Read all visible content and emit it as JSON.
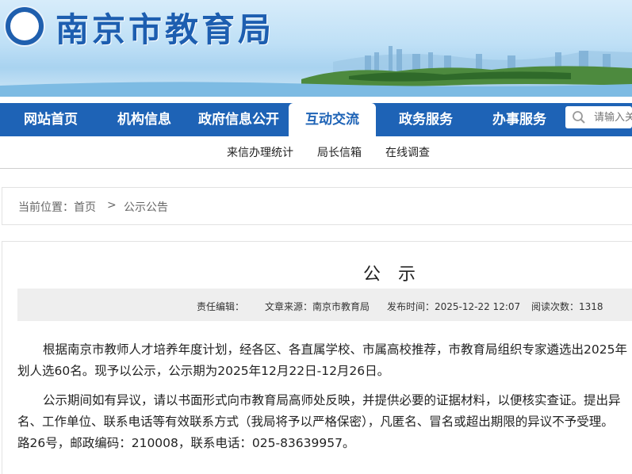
{
  "header": {
    "site_title": "南京市教育局",
    "logo_name": "nanjing-education-emblem"
  },
  "nav": {
    "items": [
      {
        "label": "网站首页"
      },
      {
        "label": "机构信息"
      },
      {
        "label": "政府信息公开"
      },
      {
        "label": "互动交流",
        "active": true
      },
      {
        "label": "政务服务"
      },
      {
        "label": "办事服务"
      }
    ],
    "search_placeholder": "请输入关",
    "colors": {
      "nav_bg": "#1e63b6",
      "active_text": "#1e63b6"
    }
  },
  "subnav": {
    "items": [
      {
        "label": "来信办理统计"
      },
      {
        "label": "局长信箱"
      },
      {
        "label": "在线调查"
      }
    ]
  },
  "breadcrumb": {
    "prefix": "当前位置：",
    "home": "首页",
    "separator": ">",
    "current": "公示公告"
  },
  "article": {
    "title": "公示",
    "meta": {
      "editor": "责任编辑：",
      "source": "文章来源：南京市教育局",
      "published": "发布时间：2025-12-22 12:07",
      "views": "阅读次数：1318"
    },
    "paragraphs": [
      {
        "line1": "根据南京市教师人才培养年度计划，经各区、各直属学校、市属高校推荐，市教育局组织专家遴选出2025年",
        "line2": "划人选60名。现予以公示，公示期为2025年12月22日-12月26日。"
      },
      {
        "line1": "公示期间如有异议，请以书面形式向市教育局高师处反映，并提供必要的证据材料，以便核实查证。提出异",
        "line2": "名、工作单位、联系电话等有效联系方式（我局将予以严格保密），凡匿名、冒名或超出期限的异议不予受理。",
        "line3": "路26号，邮政编码：210008，联系电话：025-83639957。"
      }
    ]
  }
}
